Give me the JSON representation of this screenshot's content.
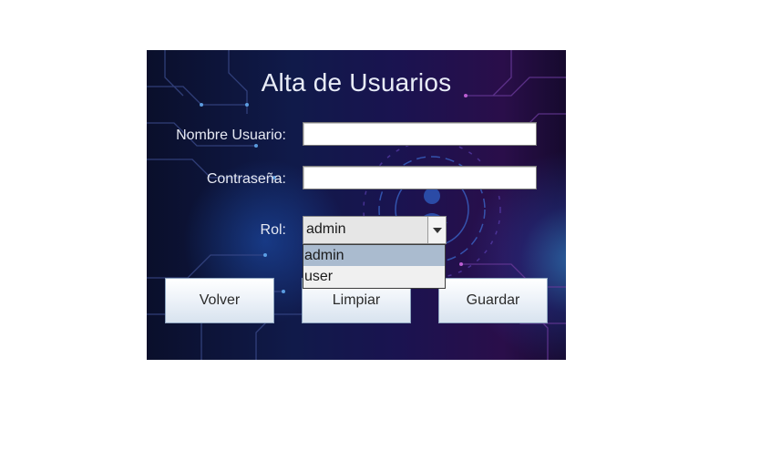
{
  "window": {
    "title": "Alta de Usuarios"
  },
  "form": {
    "username_label": "Nombre Usuario:",
    "username_value": "",
    "password_label": "Contraseña:",
    "password_value": "",
    "role_label": "Rol:",
    "role_value": "admin",
    "role_options": [
      "admin",
      "user"
    ]
  },
  "buttons": {
    "back": "Volver",
    "clear": "Limpiar",
    "save": "Guardar"
  },
  "colors": {
    "button_border": "#8ea5c0",
    "selected_option": "#aabbcf",
    "background_dark": "#0a0f2b",
    "accent_blue": "#3caaff",
    "accent_magenta": "#e63cd2"
  }
}
